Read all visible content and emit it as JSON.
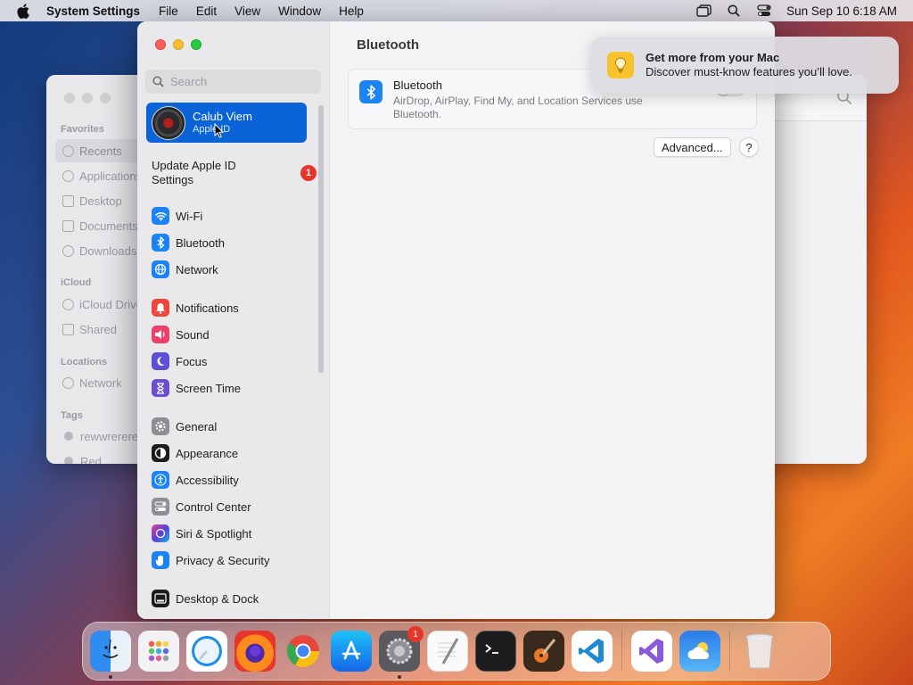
{
  "menubar": {
    "app_name": "System Settings",
    "menus": [
      "File",
      "Edit",
      "View",
      "Window",
      "Help"
    ],
    "clock": "Sun Sep 10  6:18 AM"
  },
  "finder": {
    "favorites_label": "Favorites",
    "favorites": [
      "Recents",
      "Applications",
      "Desktop",
      "Documents",
      "Downloads"
    ],
    "icloud_label": "iCloud",
    "icloud": [
      "iCloud Drive",
      "Shared"
    ],
    "locations_label": "Locations",
    "locations": [
      "Network"
    ],
    "tags_label": "Tags",
    "tags": [
      "rewwrerere",
      "Red"
    ]
  },
  "settings": {
    "search_placeholder": "Search",
    "profile": {
      "name": "Calub Viem",
      "subtitle": "Apple ID"
    },
    "update": {
      "label": "Update Apple ID Settings",
      "count": "1"
    },
    "nav": [
      {
        "label": "Wi-Fi",
        "icon": "wifi-icon",
        "color": "#1b84f2"
      },
      {
        "label": "Bluetooth",
        "icon": "bluetooth-icon",
        "color": "#1b84f2"
      },
      {
        "label": "Network",
        "icon": "globe-icon",
        "color": "#1b84f2"
      },
      {
        "label": "Notifications",
        "icon": "bell-icon",
        "color": "#f0453a"
      },
      {
        "label": "Sound",
        "icon": "speaker-icon",
        "color": "#ef3f6b"
      },
      {
        "label": "Focus",
        "icon": "moon-icon",
        "color": "#5d4fd6"
      },
      {
        "label": "Screen Time",
        "icon": "hourglass-icon",
        "color": "#6a4fd0"
      },
      {
        "label": "General",
        "icon": "gear-icon",
        "color": "#8e8e93"
      },
      {
        "label": "Appearance",
        "icon": "appearance-icon",
        "color": "#1c1c1e"
      },
      {
        "label": "Accessibility",
        "icon": "accessibility-icon",
        "color": "#1b84f2"
      },
      {
        "label": "Control Center",
        "icon": "toggles-icon",
        "color": "#8e8e93"
      },
      {
        "label": "Siri & Spotlight",
        "icon": "siri-icon",
        "color": "#8a3fd1"
      },
      {
        "label": "Privacy & Security",
        "icon": "hand-icon",
        "color": "#1b84f2"
      },
      {
        "label": "Desktop & Dock",
        "icon": "dock-icon",
        "color": "#1c1c1e"
      }
    ],
    "content_title": "Bluetooth",
    "bt_card": {
      "title": "Bluetooth",
      "desc": "AirDrop, AirPlay, Find My, and Location Services use Bluetooth.",
      "enabled": false
    },
    "advanced_label": "Advanced...",
    "help_label": "?"
  },
  "notification": {
    "title": "Get more from your Mac",
    "body": "Discover must-know features you’ll love."
  },
  "dock": {
    "items": [
      "Finder",
      "Launchpad",
      "Safari",
      "Firefox",
      "Chrome",
      "App Store",
      "System Settings",
      "TextEdit",
      "Terminal",
      "GarageBand",
      "Visual Studio Code",
      "Visual Studio",
      "Weather",
      "Trash"
    ],
    "settings_badge": "1"
  }
}
